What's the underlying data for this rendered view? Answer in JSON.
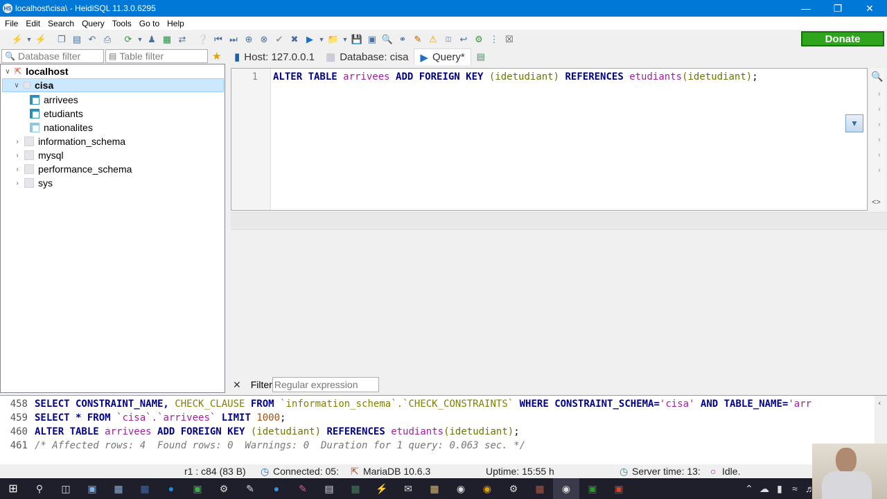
{
  "window": {
    "title": "localhost\\cisa\\ - HeidiSQL 11.3.0.6295",
    "app_icon": "HS"
  },
  "menu": [
    "File",
    "Edit",
    "Search",
    "Query",
    "Tools",
    "Go to",
    "Help"
  ],
  "donate": "Donate",
  "filters": {
    "database": "Database filter",
    "table": "Table filter"
  },
  "tree": {
    "host": "localhost",
    "db": "cisa",
    "tables": [
      "arrivees",
      "etudiants",
      "nationalites"
    ],
    "other_dbs": [
      "information_schema",
      "mysql",
      "performance_schema",
      "sys"
    ]
  },
  "tabs": {
    "host": "Host: 127.0.0.1",
    "database": "Database: cisa",
    "query": "Query*"
  },
  "editor": {
    "line": "1",
    "t1": "ALTER TABLE ",
    "t2": "arrivees",
    "t3": " ADD FOREIGN KEY ",
    "t4": "(idetudiant)",
    "t5": " REFERENCES ",
    "t6": "etudiants",
    "t7": "(idetudiant)",
    "t8": ";"
  },
  "result_filter": {
    "label": "Filter",
    "placeholder": "Regular expression"
  },
  "log": {
    "l1": {
      "n": "458",
      "a": "SELECT CONSTRAINT_NAME, ",
      "b": "CHECK_CLAUSE",
      "c": " FROM ",
      "d": "`information_schema`.`CHECK_CONSTRAINTS`",
      "e": " WHERE CONSTRAINT_SCHEMA=",
      "f": "'cisa'",
      "g": " AND TABLE_NAME=",
      "h": "'arr"
    },
    "l2": {
      "n": "459",
      "a": "SELECT * FROM ",
      "b": "`cisa`.`arrivees`",
      "c": " LIMIT ",
      "d": "1000",
      "e": ";"
    },
    "l3": {
      "n": "460",
      "a": "ALTER TABLE ",
      "b": "arrivees",
      "c": " ADD FOREIGN KEY ",
      "d": "(idetudiant)",
      "e": " REFERENCES ",
      "f": "etudiants",
      "g": "(idetudiant)",
      "h": ";"
    },
    "l4": {
      "n": "461",
      "a": "/* Affected rows: 4  Found rows: 0  Warnings: 0  Duration for 1 query: 0.063 sec. */"
    }
  },
  "status": {
    "pos": "r1 : c84 (83 B)",
    "conn": "Connected: 05:",
    "server": "MariaDB 10.6.3",
    "uptime": "Uptime: 15:55 h",
    "time": "Server time: 13:",
    "state": "Idle."
  }
}
